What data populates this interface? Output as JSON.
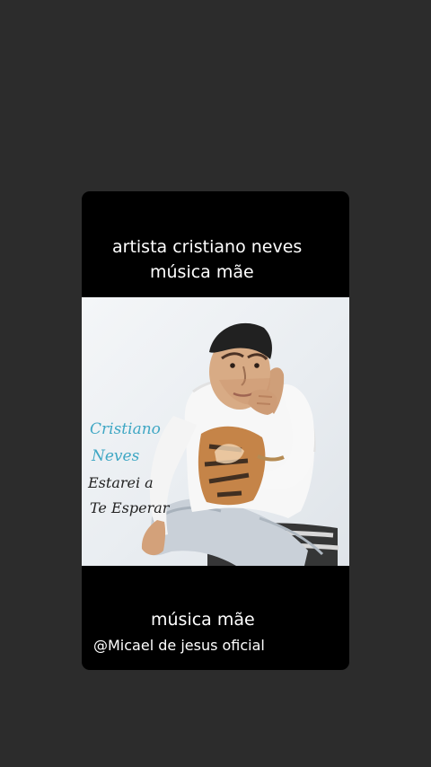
{
  "story": {
    "top_line_1": "artista cristiano neves",
    "top_line_2": "música mãe",
    "bottom_title": "música mãe",
    "bottom_handle": "@Micael de jesus oficial"
  },
  "album_cover": {
    "artist_line_1": "Cristiano",
    "artist_line_2": "Neves",
    "album_line_1": "Estarei a",
    "album_line_2": "Te Esperar"
  }
}
